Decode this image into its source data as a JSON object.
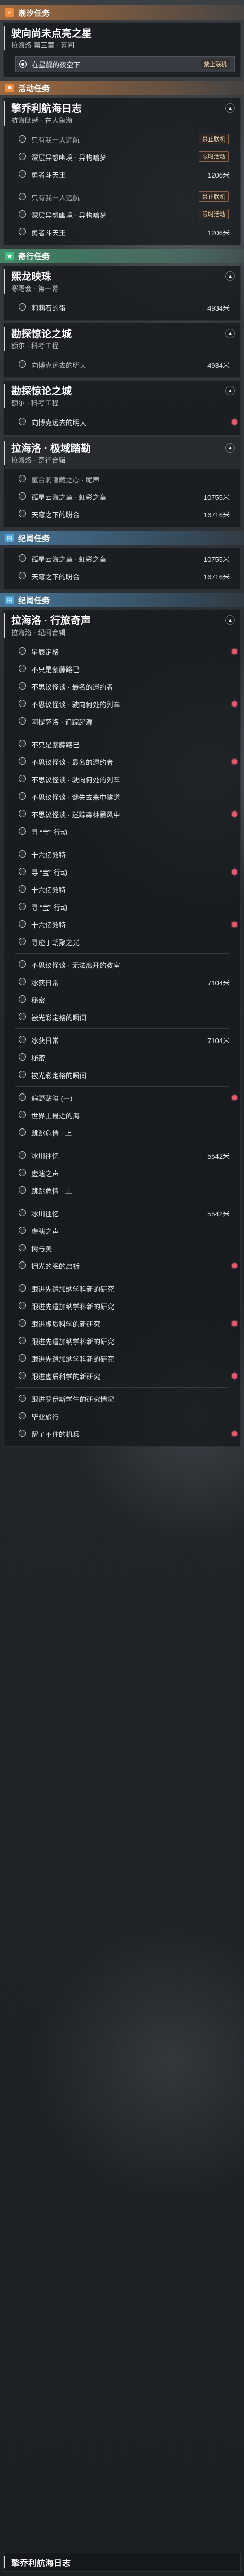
{
  "sections": {
    "trial": {
      "label": "潮汐任务",
      "icon": "lightning-icon"
    },
    "story": {
      "label": "活动任务",
      "icon": "flag-icon"
    },
    "companion": {
      "label": "奇行任务",
      "icon": "star-icon"
    },
    "chronicle": {
      "label": "纪闻任务",
      "icon": "book-icon"
    }
  },
  "trial_quest": {
    "title": "驶向尚未点亮之星",
    "subtitle": "拉海洛 第三章 · 幕间",
    "steps": [
      "在星舰的夜空下"
    ],
    "tag": "禁止联机"
  },
  "story_quest_1": {
    "title": "擎乔利航海日志",
    "subtitle": "航海随感 · 在人鱼海",
    "tag1": "禁止联机",
    "tag2": "限时活动",
    "steps": [
      {
        "label": "只有我一人远航",
        "dist": ""
      },
      {
        "label": "深层异想幽境 · 异构暗梦",
        "dist": ""
      },
      {
        "label": "勇者斗天王",
        "dist": "1206米"
      },
      {
        "label": "只有我一人远航",
        "dist": ""
      },
      {
        "label": "深层异想幽境 · 异构暗梦",
        "dist": ""
      },
      {
        "label": "勇者斗天王",
        "dist": "1206米"
      }
    ]
  },
  "companion_quests": [
    {
      "title": "熙龙映珠",
      "subtitle": "寒霜会 · 第一幕",
      "steps": [
        {
          "label": "莉莉石的蛋",
          "dist": "4934米"
        }
      ]
    },
    {
      "title": "勘探惊论之城",
      "subtitle": "额尔 · 科考工程",
      "steps": [
        {
          "label": "向博克远去的明天",
          "dist": "4934米"
        }
      ]
    },
    {
      "title": "勘探惊论之城",
      "subtitle": "额尔 · 科考工程",
      "steps": [
        {
          "label": "向博克远去的明天",
          "dist": ""
        }
      ]
    },
    {
      "title": "拉海洛 · 极域踏勘",
      "subtitle": "拉海洛 · 奇行合辑",
      "steps": [
        {
          "label": "蜜合洞隐藏之心 · 尾声",
          "dist": ""
        },
        {
          "label": "孤星云海之章 · 虹彩之章",
          "dist": "10755米"
        },
        {
          "label": "天穹之下的盼合",
          "dist": "16716米"
        }
      ]
    }
  ],
  "chronicle_extra_steps": [
    {
      "label": "孤星云海之章 · 虹彩之章",
      "dist": "10755米"
    },
    {
      "label": "天穹之下的盼合",
      "dist": "16716米"
    }
  ],
  "chronicle_quest": {
    "title": "拉海洛 · 行旅奇声",
    "subtitle": "拉海洛 · 纪闻合辑",
    "steps": [
      {
        "label": "星辰定格",
        "dist": ""
      },
      {
        "label": "不只是紫藤路已",
        "dist": ""
      },
      {
        "label": "不思议怪谈 · 最名的遗约者",
        "dist": ""
      },
      {
        "label": "不思议怪谈 · 驶向何处的列车",
        "dist": ""
      },
      {
        "label": "阿提萨洛 · 追踪起源",
        "dist": ""
      },
      {
        "label": "不只是紫藤路已",
        "dist": ""
      },
      {
        "label": "不思议怪谈 · 最名的遗约者",
        "dist": ""
      },
      {
        "label": "不思议怪谈 · 驶向何处的列车",
        "dist": ""
      },
      {
        "label": "不思议怪谈 · 谜失去来中隧道",
        "dist": ""
      },
      {
        "label": "不思议怪谈 · 迷踪森林暴风中",
        "dist": ""
      },
      {
        "label": "寻 “宝” 行动",
        "dist": ""
      },
      {
        "label": "十六亿效特",
        "dist": ""
      },
      {
        "label": "寻 “宝” 行动",
        "dist": ""
      },
      {
        "label": "十六亿效特",
        "dist": ""
      },
      {
        "label": "寻 “宝” 行动",
        "dist": ""
      },
      {
        "label": "十六亿效特",
        "dist": ""
      },
      {
        "label": "寻迹于朝聚之光",
        "dist": ""
      },
      {
        "label": "不思议怪谈 · 无法离开的教室",
        "dist": ""
      },
      {
        "label": "冰获日常",
        "dist": "7104米"
      },
      {
        "label": "秘密",
        "dist": ""
      },
      {
        "label": "被光彩定格的瞬间",
        "dist": ""
      },
      {
        "label": "冰获日常",
        "dist": "7104米"
      },
      {
        "label": "秘密",
        "dist": ""
      },
      {
        "label": "被光彩定格的瞬间",
        "dist": ""
      },
      {
        "label": "遍野贴陷 (一)",
        "dist": ""
      },
      {
        "label": "世界上最近的海",
        "dist": ""
      },
      {
        "label": "跳跳危情 · 上",
        "dist": ""
      },
      {
        "label": "冰川往忆",
        "dist": "5542米"
      },
      {
        "label": "虚瞎之声",
        "dist": ""
      },
      {
        "label": "跳跳危情 · 上",
        "dist": ""
      },
      {
        "label": "冰川往忆",
        "dist": "5542米"
      },
      {
        "label": "虚瞎之声",
        "dist": ""
      },
      {
        "label": "树与美",
        "dist": ""
      },
      {
        "label": "拥光的眠的启祈",
        "dist": ""
      },
      {
        "label": "跟进先遣加纳学科新的研究",
        "dist": ""
      },
      {
        "label": "跟进先遣加纳学科新的研究",
        "dist": ""
      },
      {
        "label": "跟进虚质科学的新研究",
        "dist": ""
      },
      {
        "label": "跟进先遣加纳学科新的研究",
        "dist": ""
      },
      {
        "label": "跟进先遣加纳学科新的研究",
        "dist": ""
      },
      {
        "label": "跟进虚质科学的新研究",
        "dist": ""
      },
      {
        "label": "跟进罗伊斯学生的研究情况",
        "dist": ""
      },
      {
        "label": "毕业旅行",
        "dist": ""
      },
      {
        "label": "留了不住的机兵",
        "dist": ""
      }
    ]
  },
  "footer": {
    "title": "擎乔利航海日志"
  }
}
